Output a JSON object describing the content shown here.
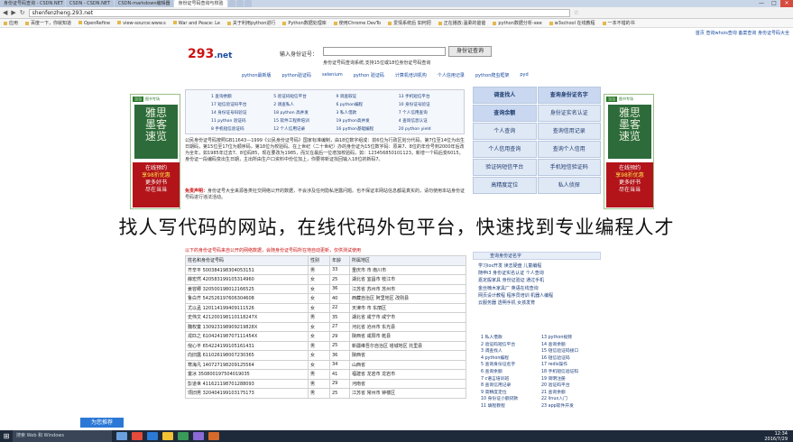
{
  "browser": {
    "tabs": [
      "身份证号码查询 - CSDN.NET",
      "CSDN - CSDN.NET",
      "CSDN-markdown编辑器",
      "身份证号码查询与校验",
      "",
      "",
      ""
    ],
    "url": "shenfenzheng.293.net",
    "bookmarks": [
      "应用",
      "百度一下，你就知道",
      "OpenRefine",
      "view-source:www.s",
      "War and Peace: Le",
      "关于利用python进行",
      "Python数据处理库",
      "使用Chrome DevTo",
      "爱情系统后 如何把",
      "正在播放:温柔的爸爸",
      "python数据分析-xee",
      "w3school 在线教程",
      "一本不错的书"
    ],
    "win_controls": [
      "—",
      "□",
      "×"
    ]
  },
  "site": {
    "top_links": "首页 查询whois查询 备案查询 身份证号码大全",
    "logo_main": "293",
    "logo_suffix": ".net",
    "search_label": "输入身份证号：",
    "search_button": "身份证查询",
    "tagline": "身份证号码查询系统,支持15位或18位身份证号码查询",
    "nav": [
      "python最新版",
      "python验证码",
      "selenium",
      "python 验证码",
      "计算机培训机构",
      "个人信用记录",
      "python爬虫框架",
      "pyd"
    ]
  },
  "services": [
    "1 查询余额",
    "5 验证码短信平台",
    "9 调查取证",
    "13 手机短信平台",
    "17 短信验证码平台",
    "2 调查私人",
    "6 python编程",
    "10 身份证号验证",
    "14 身份证号码验证",
    "18 python 高并发",
    "3 私人借款",
    "7 个人信用查询",
    "11 python 验证码",
    "15 软件工程师培训",
    "19 python高并发",
    "4 查询信息认证",
    "8 手机短信验证码",
    "12 个人信用记录",
    "16 python基础编程",
    "20 python yield"
  ],
  "intro": "公民身份证号码按照GB11643—1999《公民身份证号码》国家标准编制，由18位数字组成：前6位为行政区划分代码，第7位至14位为出生日期码，第15位至17位为顺序码，第18位为校验码。在上世纪（二十世纪）办的身份证为15位数字码：原来7、8位的年份号到2000年后改为全年，如1985年过去7、8位码85，现在要改为1985，而又在最后一位增加校验码，如：123456850101123，新增一个码后变6015，身份证一段编码变出生日期，主出所由生户口资料中份位加上，你要将新证找回输入18位的新码7。",
  "intro2_title": "免责声明：",
  "intro2": "身份证号大全来源各类社交网络公开的数据，不会涉及任何隐私泄露问题。也不保证本网站信息都是真实的，请勿使用本站身份证号码进行违法活动。",
  "overlay": "找人写代码的网站，在线代码外包平台，快速找到专业编程人才",
  "right_boxes": [
    "调查找人",
    "查询身份证名字",
    "查询余额",
    "身份证实名认证",
    "个人查询",
    "查询信用记录",
    "个人信用查询",
    "查询个人信用",
    "验证码短信平台",
    "手机短信验证码",
    "高精度定位",
    "私人侦探"
  ],
  "table": {
    "note": "以下的身份证号码来自公开的网络数据，会随身份证号码所在地自动更新，仅供测试使用",
    "headers": [
      "姓名和身份证号码",
      "性别",
      "年龄",
      "所属地区"
    ],
    "rows": [
      [
        "齐辛平 500384198304053151",
        "男",
        "33",
        "重庆市 市 南川市"
      ],
      [
        "薛宏然 420583199105314960",
        "女",
        "25",
        "湖北省 宜昌市 枝江市"
      ],
      [
        "姜容卿 320500198012166525",
        "女",
        "36",
        "江苏省 苏州市 苏州市"
      ],
      [
        "鲁白齐 542526197606304608",
        "女",
        "40",
        "西藏自治区 阿里地区 改则县"
      ],
      [
        "尤以孟 120114199409111526",
        "女",
        "22",
        "天津市 市 东丽区"
      ],
      [
        "史伟文 421200198110118247X",
        "男",
        "35",
        "湖北省 咸宁市 咸宁市"
      ],
      [
        "魏权童 130923198909219828X",
        "女",
        "27",
        "河北省 沧州市 东光县"
      ],
      [
        "戎匹之 610424198707111454X",
        "女",
        "29",
        "陕西省 咸阳市 乾县"
      ],
      [
        "倪心平 654224199105161431",
        "男",
        "25",
        "新疆维吾尔自治区 塔城地区 托里县"
      ],
      [
        "向旧露 611026198007230365",
        "女",
        "36",
        "陕西省"
      ],
      [
        "寒海凡 140727198209125564",
        "女",
        "34",
        "山西省"
      ],
      [
        "童冰 350800197504019035",
        "男",
        "41",
        "福建省 龙岩市 龙岩市"
      ],
      [
        "彭道世 411621198701288093",
        "男",
        "29",
        "河南省"
      ],
      [
        "项旧男 320404199103175173",
        "男",
        "25",
        "江苏省 常州市 钟楼区"
      ]
    ]
  },
  "calc_head": "查询身份证名字",
  "right_list1": [
    "学习ios开发  读志硬盘  儿童编程",
    "随申i3  身份证实名认证  个人查询",
    "嘉定般家具  身份证验证  通过手机",
    "金丝楠木家具厂  英语在线查询",
    "网页设计教程  程序员培训  机器人编程",
    "云服务器  透明手机  女孩发育"
  ],
  "right_list2": [
    "1 私人借款",
    "13 python视频",
    "2 验证码短信平台",
    "14 查询余额",
    "3 调查找人",
    "15 短信验证码接口",
    "4 python编程",
    "16 短信验证码",
    "5 查询身份证名字",
    "17 redis操作",
    "6 查询余额",
    "18 手机短信验证码",
    "7 c语言培训班",
    "19 简明注册",
    "8 查询信用记录",
    "20 验证码平台",
    "9 高精度定位",
    "21 查询余额",
    "10 身份证小额贷款",
    "22 linux入门",
    "11 填程教程",
    "23 app软件开发"
  ],
  "taskbar": {
    "search": "搜索 Web 和 Windows",
    "feedback": "为您推荐",
    "time": "12:34",
    "date": "2016/7/29"
  }
}
